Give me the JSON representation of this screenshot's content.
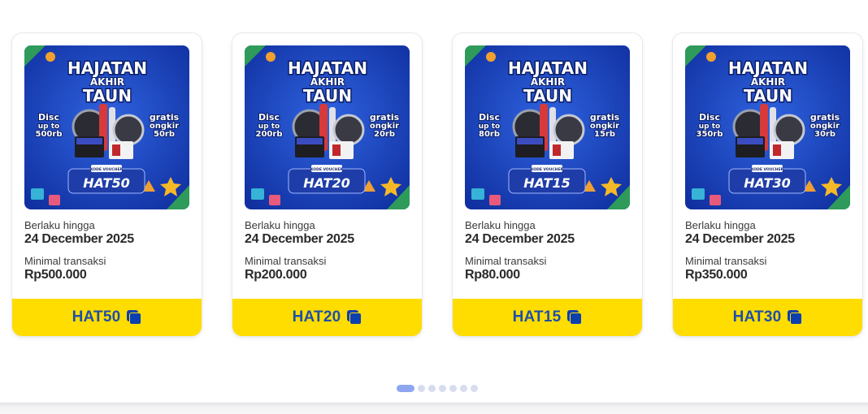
{
  "theme": {
    "code_bar_color": "#ffdd00",
    "code_text_color": "#1f4fa8",
    "banner_blue": "#1a3fb5",
    "dot_active": "#8ea6f0",
    "dot_inactive": "#d8dcef"
  },
  "labels": {
    "valid_until": "Berlaku hingga",
    "min_transaction": "Minimal transaksi"
  },
  "banner_text": {
    "line1": "HAJATAN",
    "line2": "AKHIR",
    "line3": "TAUN",
    "disc": "Disc",
    "up_to": "up to",
    "gratis": "gratis",
    "ongkir": "ongkir",
    "kode_voucher": "KODE VOUCHER"
  },
  "vouchers": [
    {
      "code": "HAT50",
      "disc_amount": "500rb",
      "ongkir_amount": "50rb",
      "valid_until": "24 December 2025",
      "min_transaction": "Rp500.000",
      "copy_icon": "copy-icon"
    },
    {
      "code": "HAT20",
      "disc_amount": "200rb",
      "ongkir_amount": "20rb",
      "valid_until": "24 December 2025",
      "min_transaction": "Rp200.000",
      "copy_icon": "copy-icon"
    },
    {
      "code": "HAT15",
      "disc_amount": "80rb",
      "ongkir_amount": "15rb",
      "valid_until": "24 December 2025",
      "min_transaction": "Rp80.000",
      "copy_icon": "copy-icon"
    },
    {
      "code": "HAT30",
      "disc_amount": "350rb",
      "ongkir_amount": "30rb",
      "valid_until": "24 December 2025",
      "min_transaction": "Rp350.000",
      "copy_icon": "copy-icon"
    }
  ],
  "pagination": {
    "total": 7,
    "active": 1
  }
}
